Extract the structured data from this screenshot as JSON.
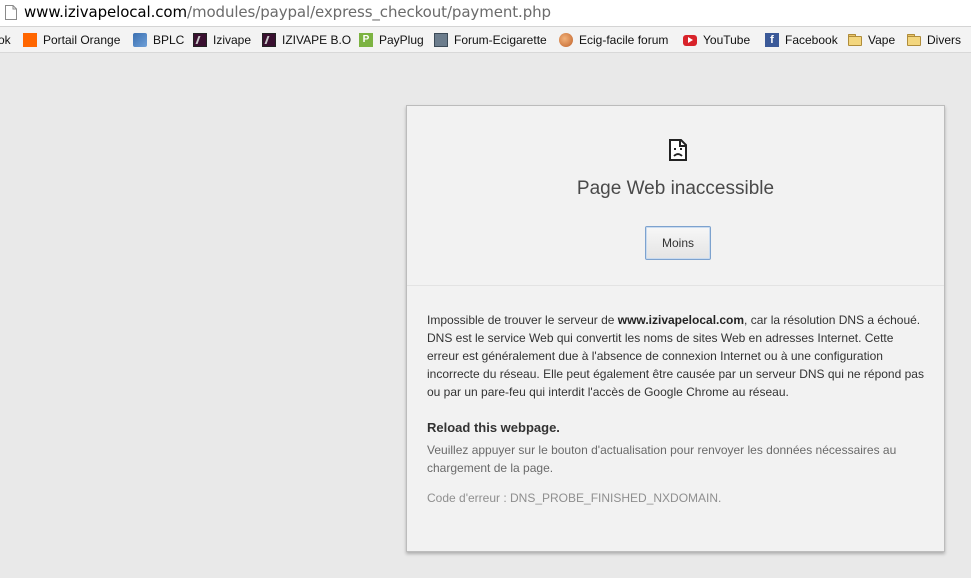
{
  "browser": {
    "url_host": "www.izivapelocal.com",
    "url_path": "/modules/paypal/express_checkout/payment.php",
    "bookmarks": [
      {
        "label": "ok",
        "icon": "cut-off-icon"
      },
      {
        "label": "Portail Orange",
        "icon": "orange-icon"
      },
      {
        "label": "BPLC",
        "icon": "bplc-icon"
      },
      {
        "label": "Izivape",
        "icon": "izivape-icon"
      },
      {
        "label": "IZIVAPE B.O",
        "icon": "izivape-icon"
      },
      {
        "label": "PayPlug",
        "icon": "payplug-icon"
      },
      {
        "label": "Forum-Ecigarette",
        "icon": "forum-icon"
      },
      {
        "label": "Ecig-facile forum",
        "icon": "ecig-icon"
      },
      {
        "label": "YouTube",
        "icon": "youtube-icon"
      },
      {
        "label": "Facebook",
        "icon": "facebook-icon"
      },
      {
        "label": "Vape",
        "icon": "folder-icon"
      },
      {
        "label": "Divers",
        "icon": "folder-icon"
      }
    ]
  },
  "error": {
    "title": "Page Web inaccessible",
    "button_label": "Moins",
    "desc_before": "Impossible de trouver le serveur de ",
    "desc_host": "www.izivapelocal.com",
    "desc_after": ", car la résolution DNS a échoué. DNS est le service Web qui convertit les noms de sites Web en adresses Internet. Cette erreur est généralement due à l'absence de connexion Internet ou à une configuration incorrecte du réseau. Elle peut également être causée par un serveur DNS qui ne répond pas ou par un pare-feu qui interdit l'accès de Google Chrome au réseau.",
    "reload_title": "Reload this webpage.",
    "reload_text": "Veuillez appuyer sur le bouton d'actualisation pour renvoyer les données nécessaires au chargement de la page.",
    "error_code": "Code d'erreur : DNS_PROBE_FINISHED_NXDOMAIN."
  },
  "colors": {
    "page_background": "#e9e9e9",
    "button_border": "#7da2ce"
  }
}
